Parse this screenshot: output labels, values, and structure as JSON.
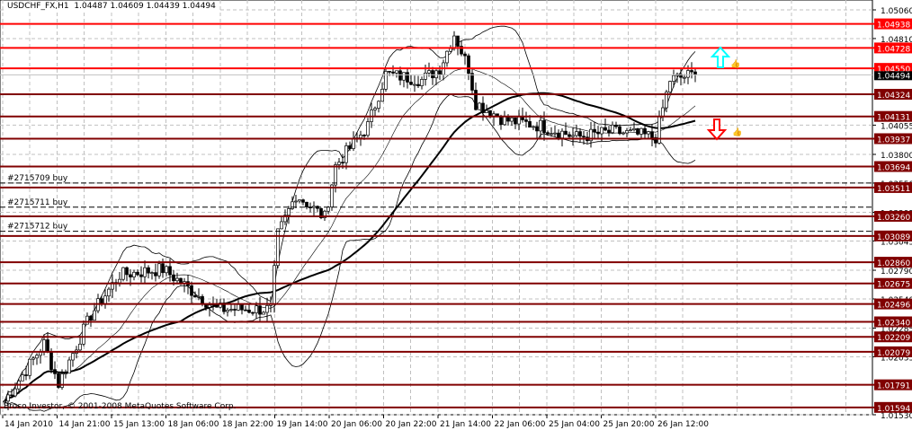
{
  "header": {
    "symbol": "USDCHF_FX,H1",
    "open": "1.04487",
    "high": "1.04609",
    "low": "1.04439",
    "close": "1.04494"
  },
  "copyright": "Broco Investor, © 2001-2008 MetaQuotes Software Corp.",
  "colors": {
    "resistance": "#ff0000",
    "support": "#800000",
    "up_arrow": "#00ffff",
    "down_arrow": "#ff0000",
    "candle": "#000000",
    "grid": "#c0c0c0"
  },
  "chart_data": {
    "type": "candlestick",
    "title": "USDCHF_FX,H1",
    "ylim": [
      1.0153,
      1.0506
    ],
    "x_ticks": [
      "14 Jan 2010",
      "14 Jan 21:00",
      "15 Jan 13:00",
      "18 Jan 06:00",
      "18 Jan 22:00",
      "19 Jan 14:00",
      "20 Jan 06:00",
      "20 Jan 22:00",
      "21 Jan 14:00",
      "22 Jan 06:00",
      "25 Jan 04:00",
      "25 Jan 20:00",
      "26 Jan 12:00"
    ],
    "y_ticks": [
      "1.05060",
      "1.04810",
      "1.04055",
      "1.03800",
      "1.03550",
      "1.03295",
      "1.03045",
      "1.02790",
      "1.02540",
      "1.02285",
      "1.02035",
      "1.01530"
    ],
    "current_price": "1.04494",
    "levels": [
      {
        "price": "1.04938",
        "kind": "resistance"
      },
      {
        "price": "1.04728",
        "kind": "resistance"
      },
      {
        "price": "1.04550",
        "kind": "resistance"
      },
      {
        "price": "1.04324",
        "kind": "support"
      },
      {
        "price": "1.04131",
        "kind": "support"
      },
      {
        "price": "1.03937",
        "kind": "support"
      },
      {
        "price": "1.03694",
        "kind": "support"
      },
      {
        "price": "1.03511",
        "kind": "support"
      },
      {
        "price": "1.03260",
        "kind": "support"
      },
      {
        "price": "1.03089",
        "kind": "support"
      },
      {
        "price": "1.02860",
        "kind": "support"
      },
      {
        "price": "1.02675",
        "kind": "support"
      },
      {
        "price": "1.02496",
        "kind": "support"
      },
      {
        "price": "1.02340",
        "kind": "support"
      },
      {
        "price": "1.02209",
        "kind": "support"
      },
      {
        "price": "1.02079",
        "kind": "support"
      },
      {
        "price": "1.01791",
        "kind": "support"
      },
      {
        "price": "1.01594",
        "kind": "support"
      }
    ],
    "orders": [
      {
        "label": "#2715709 buy",
        "price": 1.0355
      },
      {
        "label": "#2715711 buy",
        "price": 1.0334
      },
      {
        "label": "#2715712 buy",
        "price": 1.0313
      }
    ],
    "price_path": [
      [
        0,
        1.0165
      ],
      [
        11,
        1.0215
      ],
      [
        15,
        1.018
      ],
      [
        24,
        1.024
      ],
      [
        32,
        1.0275
      ],
      [
        44,
        1.028
      ],
      [
        59,
        1.0245
      ],
      [
        74,
        1.0245
      ],
      [
        76,
        1.031
      ],
      [
        81,
        1.0345
      ],
      [
        89,
        1.0325
      ],
      [
        92,
        1.037
      ],
      [
        101,
        1.0405
      ],
      [
        106,
        1.045
      ],
      [
        116,
        1.0445
      ],
      [
        121,
        1.0455
      ],
      [
        125,
        1.0485
      ],
      [
        129,
        1.0455
      ],
      [
        131,
        1.0425
      ],
      [
        139,
        1.041
      ],
      [
        149,
        1.0405
      ],
      [
        159,
        1.0395
      ],
      [
        169,
        1.04
      ],
      [
        181,
        1.0395
      ],
      [
        185,
        1.0445
      ],
      [
        192,
        1.045
      ]
    ]
  }
}
